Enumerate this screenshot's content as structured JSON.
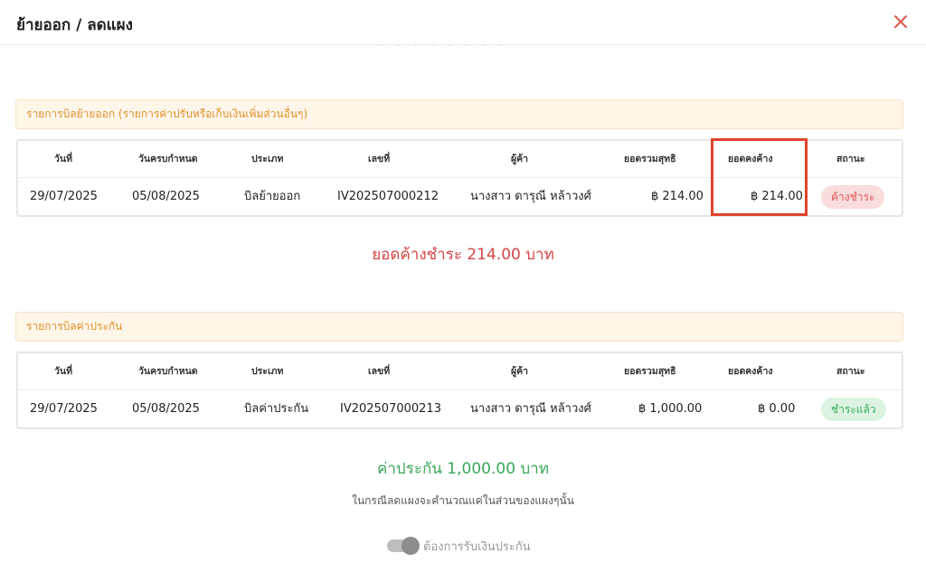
{
  "header": {
    "title": "ย้ายออก / ลดแผง",
    "close_icon": "close-icon",
    "close_color": "#e05a4a"
  },
  "columns": [
    "วันที่",
    "วันครบกำหนด",
    "ประเภท",
    "เลขที่",
    "ผู้ค้า",
    "ยอดรวมสุทธิ",
    "ยอดคงค้าง",
    "สถานะ"
  ],
  "move_out": {
    "section_title": "รายการบิลย้ายออก (รายการค่าปรับหรือเก็บเงินเพิ่มส่วนอื่นๆ)",
    "row": {
      "date": "29/07/2025",
      "due_date": "05/08/2025",
      "type": "บิลย้ายออก",
      "number": "IV202507000212",
      "vendor": "นางสาว ดารุณี หล้าวงศ์",
      "net_total": "฿ 214.00",
      "outstanding": "฿ 214.00",
      "status": "ค้างชำระ"
    },
    "total_text": "ยอดค้างชำระ 214.00 บาท"
  },
  "deposit": {
    "section_title": "รายการบิลค่าประกัน",
    "row": {
      "date": "29/07/2025",
      "due_date": "05/08/2025",
      "type": "บิลค่าประกัน",
      "number": "IV202507000213",
      "vendor": "นางสาว ดารุณี หล้าวงศ์",
      "net_total": "฿ 1,000.00",
      "outstanding": "฿ 0.00",
      "status": "ชำระแล้ว"
    },
    "total_text": "ค่าประกัน 1,000.00 บาท"
  },
  "note": "ในกรณีลดแผงจะคำนวณแค่ในส่วนของแผงๆนั้น",
  "toggle": {
    "label": "ต้องการรับเงินประกัน",
    "state": "disabled"
  },
  "colors": {
    "accent_orange": "#e0902a",
    "outstanding_red": "#d34545",
    "paid_green": "#3aa65a",
    "highlight_red": "#e0432e"
  }
}
